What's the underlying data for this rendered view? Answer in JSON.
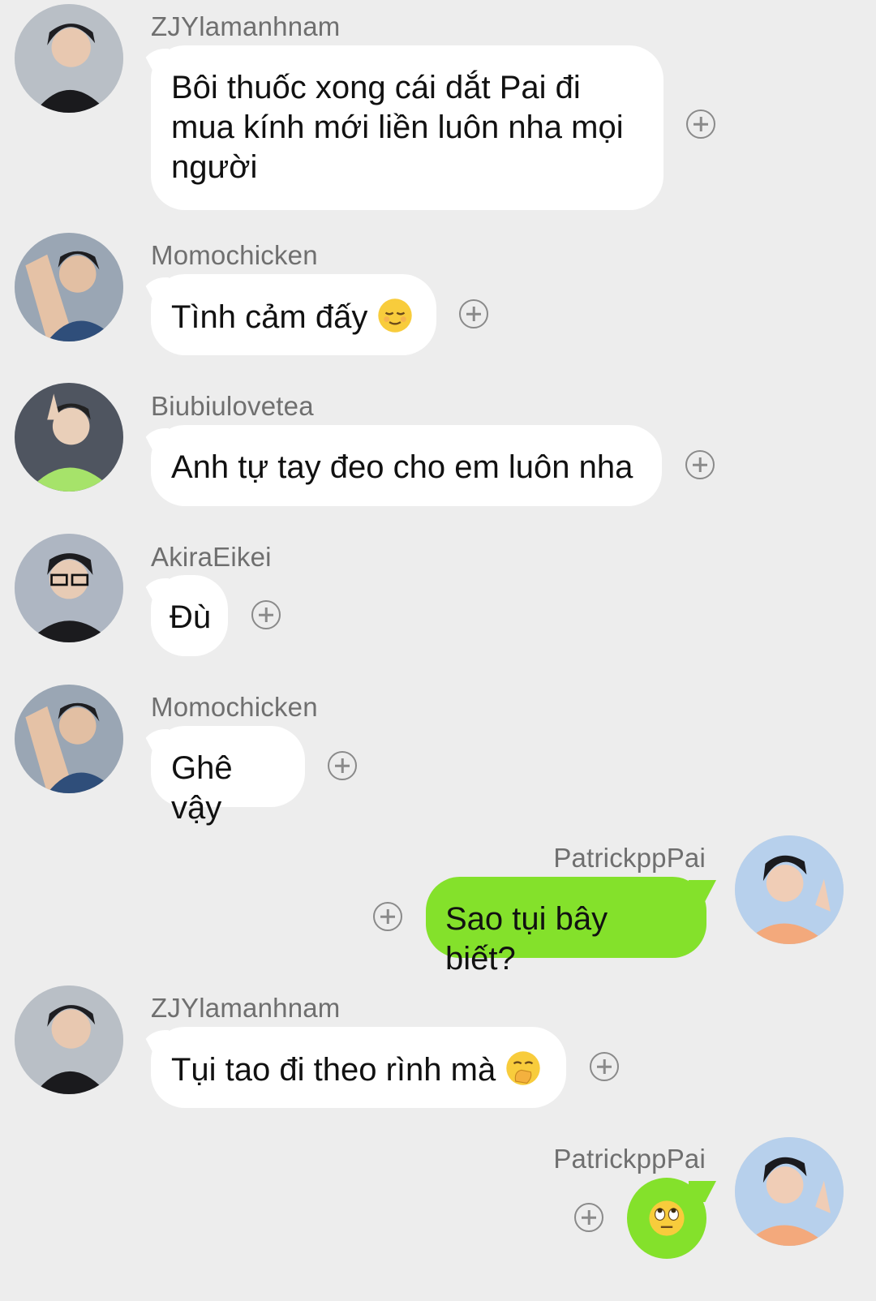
{
  "messages": [
    {
      "sender": "ZJYlamanhnam",
      "text": "Bôi thuốc xong cái dắt Pai đi mua kính mới liền luôn nha mọi người",
      "side": "left",
      "avatar": "avatar-zjy"
    },
    {
      "sender": "Momochicken",
      "text": "Tình cảm đấy",
      "emoji": "relieved-face-emoji",
      "side": "left",
      "avatar": "avatar-momo"
    },
    {
      "sender": "Biubiulovetea",
      "text": "Anh tự tay đeo cho em luôn nha",
      "side": "left",
      "avatar": "avatar-biubiu"
    },
    {
      "sender": "AkiraEikei",
      "text": "Đù",
      "side": "left",
      "avatar": "avatar-akira"
    },
    {
      "sender": "Momochicken",
      "text": "Ghê vậy",
      "side": "left",
      "avatar": "avatar-momo"
    },
    {
      "sender": "PatrickppPai",
      "text": "Sao tụi bây biết?",
      "side": "right",
      "avatar": "avatar-patrick"
    },
    {
      "sender": "ZJYlamanhnam",
      "text": "Tụi tao đi theo rình mà",
      "emoji": "hand-over-mouth-emoji",
      "side": "left",
      "avatar": "avatar-zjy"
    },
    {
      "sender": "PatrickppPai",
      "text": "",
      "emoji": "rolling-eyes-emoji",
      "side": "right",
      "avatar": "avatar-patrick"
    }
  ],
  "colors": {
    "background": "#ededed",
    "incoming_bubble": "#ffffff",
    "outgoing_bubble": "#84e12b",
    "sender_name": "#6f6f6f"
  }
}
